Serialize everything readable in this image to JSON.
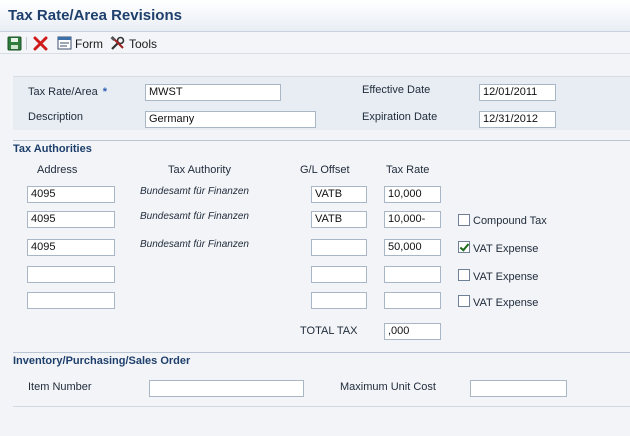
{
  "window": {
    "title": "Tax Rate/Area Revisions"
  },
  "toolbar": {
    "save_icon": "save-icon",
    "cancel_icon": "close-icon",
    "form_label": "Form",
    "tools_label": "Tools"
  },
  "header": {
    "tax_rate_area_label": "Tax Rate/Area",
    "required_marker": "*",
    "tax_rate_area_value": "MWST",
    "description_label": "Description",
    "description_value": "Germany",
    "effective_date_label": "Effective Date",
    "effective_date_value": "12/01/2011",
    "expiration_date_label": "Expiration Date",
    "expiration_date_value": "12/31/2012"
  },
  "tax_authorities": {
    "title": "Tax Authorities",
    "columns": {
      "address": "Address",
      "tax_authority": "Tax Authority",
      "gl_offset": "G/L Offset",
      "tax_rate": "Tax Rate"
    },
    "rows": [
      {
        "address": "4095",
        "authority": "Bundesamt für Finanzen",
        "gl_offset": "VATB",
        "tax_rate": "10,000",
        "option_label": "",
        "checked": false
      },
      {
        "address": "4095",
        "authority": "Bundesamt für Finanzen",
        "gl_offset": "VATB",
        "tax_rate": "10,000-",
        "option_label": "Compound Tax",
        "checked": false
      },
      {
        "address": "4095",
        "authority": "Bundesamt für Finanzen",
        "gl_offset": "",
        "tax_rate": "50,000",
        "option_label": "VAT Expense",
        "checked": true
      },
      {
        "address": "",
        "authority": "",
        "gl_offset": "",
        "tax_rate": "",
        "option_label": "VAT Expense",
        "checked": false
      },
      {
        "address": "",
        "authority": "",
        "gl_offset": "",
        "tax_rate": "",
        "option_label": "VAT Expense",
        "checked": false
      }
    ],
    "total_tax_label": "TOTAL TAX",
    "total_tax_value": ",000"
  },
  "inventory": {
    "title": "Inventory/Purchasing/Sales Order",
    "item_number_label": "Item Number",
    "item_number_value": "",
    "max_unit_cost_label": "Maximum Unit Cost",
    "max_unit_cost_value": ""
  }
}
